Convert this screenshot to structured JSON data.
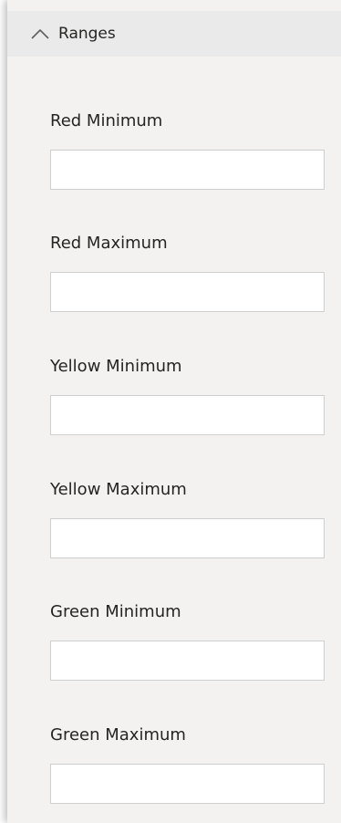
{
  "section": {
    "title": "Ranges",
    "chevron_icon": "chevron-up-icon",
    "expanded": true
  },
  "fields": [
    {
      "label": "Red Minimum",
      "value": ""
    },
    {
      "label": "Red Maximum",
      "value": ""
    },
    {
      "label": "Yellow Minimum",
      "value": ""
    },
    {
      "label": "Yellow Maximum",
      "value": ""
    },
    {
      "label": "Green Minimum",
      "value": ""
    },
    {
      "label": "Green Maximum",
      "value": ""
    }
  ]
}
